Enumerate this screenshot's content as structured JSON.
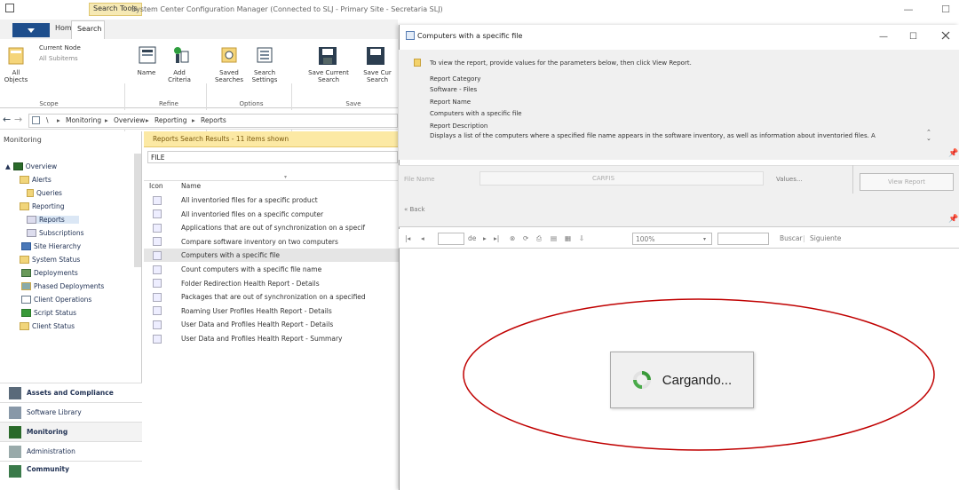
{
  "window": {
    "context_tab": "Search Tools",
    "title": "System Center Configuration Manager (Connected to SLJ - Primary Site - Secretaria SLJ)",
    "minimize": "—",
    "maximize": "☐"
  },
  "ribbon_tabs": {
    "home": "Home",
    "search": "Search"
  },
  "ribbon": {
    "current_node": "Current Node",
    "all_subitems": "All Subitems",
    "all_objects": "All Objects",
    "scope": "Scope",
    "name": "Name",
    "add_criteria": "Add Criteria",
    "refine": "Refine",
    "saved_searches": "Saved Searches",
    "search_settings": "Search Settings",
    "options": "Options",
    "save_current_search": "Save Current Search",
    "save_current_search_as": "Save Cur Search",
    "save": "Save"
  },
  "address": {
    "items": [
      "\\",
      "Monitoring",
      "Overview",
      "Reporting",
      "Reports"
    ]
  },
  "nav": {
    "header": "Monitoring",
    "items": [
      {
        "label": "Overview"
      },
      {
        "label": "Alerts"
      },
      {
        "label": "Queries"
      },
      {
        "label": "Reporting"
      },
      {
        "label": "Reports"
      },
      {
        "label": "Subscriptions"
      },
      {
        "label": "Site Hierarchy"
      },
      {
        "label": "System Status"
      },
      {
        "label": "Deployments"
      },
      {
        "label": "Phased Deployments"
      },
      {
        "label": "Client Operations"
      },
      {
        "label": "Script Status"
      },
      {
        "label": "Client Status"
      }
    ],
    "wunderbar": [
      "Assets and Compliance",
      "Software Library",
      "Monitoring",
      "Administration",
      "Community"
    ]
  },
  "results": {
    "title": "Reports Search Results - 11 items shown",
    "filter": "FILE",
    "col_icon": "Icon",
    "col_name": "Name",
    "rows": [
      "All inventoried files for a specific product",
      "All inventoried files on a specific computer",
      "Applications that are out of synchronization on a specif",
      "Compare software inventory on two computers",
      "Computers with a specific file",
      "Count computers with a specific file name",
      "Folder Redirection Health Report - Details",
      "Packages that are out of synchronization on a specified",
      "Roaming User Profiles Health Report - Details",
      "User Data and Profiles Health Report - Details",
      "User Data and Profiles Health Report - Summary"
    ],
    "selected_index": 4
  },
  "report": {
    "title": "Computers with a specific file",
    "instruction": "To view the report, provide values for the parameters below, then click View Report.",
    "category_label": "Report Category",
    "category": "Software - Files",
    "name_label": "Report Name",
    "name": "Computers with a specific file",
    "desc_label": "Report Description",
    "desc": "Displays a list of the computers where a specified file name appears in the software inventory, as well as information about inventoried files. A",
    "param_label": "File Name",
    "param_value": "CARFIS",
    "values_button": "Values...",
    "view_report": "View Report",
    "back": "« Back",
    "of": "de",
    "zoom": "100%",
    "find": "Buscar",
    "next": "Siguiente",
    "loading": "Cargando..."
  },
  "colors": {
    "accent": "#1e4e8c",
    "highlight": "#fce9a4",
    "annotation": "#c00000"
  }
}
